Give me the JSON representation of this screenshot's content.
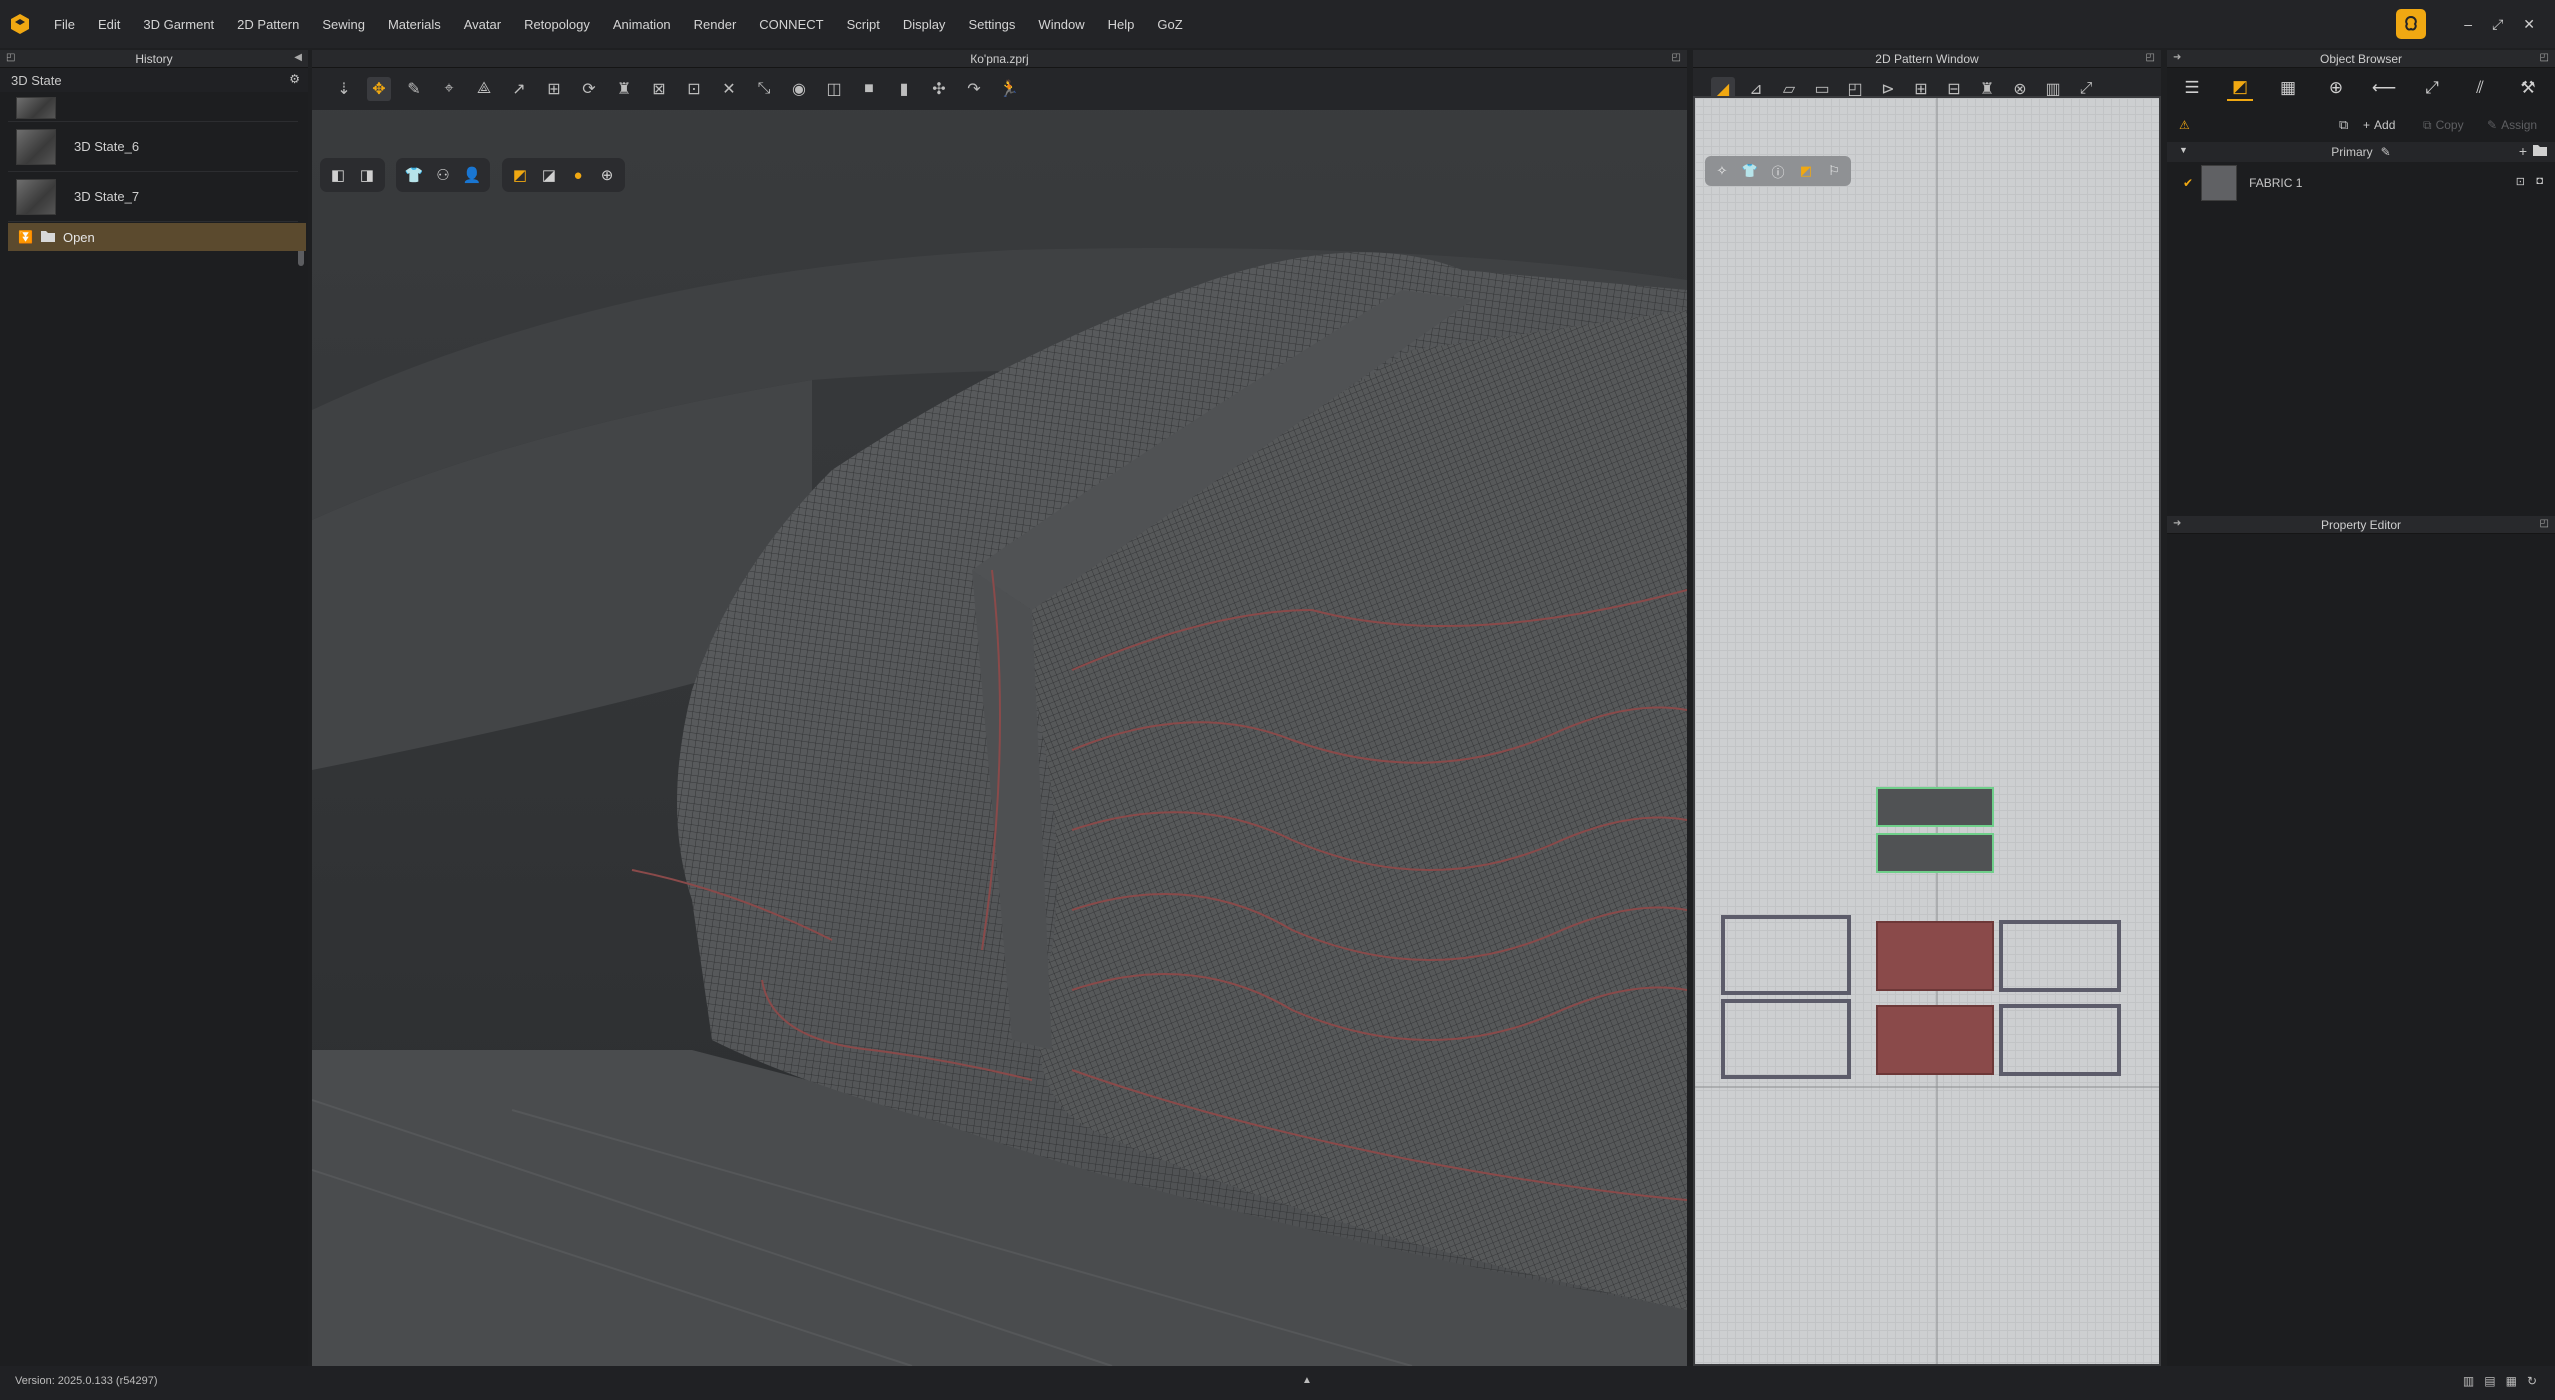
{
  "app": {
    "menu": [
      "File",
      "Edit",
      "3D Garment",
      "2D Pattern",
      "Sewing",
      "Materials",
      "Avatar",
      "Retopology",
      "Animation",
      "Render",
      "CONNECT",
      "Script",
      "Display",
      "Settings",
      "Window",
      "Help",
      "GoZ"
    ],
    "window_controls": [
      "–",
      "⤢",
      "✕"
    ]
  },
  "history": {
    "title": "History",
    "subhead": "3D State",
    "states": [
      {
        "label": "3D State_6"
      },
      {
        "label": "3D State_7"
      }
    ],
    "open_label": "Open"
  },
  "viewport": {
    "file_title": "Ко'рпа.zprj"
  },
  "pattern_window": {
    "title": "2D Pattern Window"
  },
  "object_browser": {
    "title": "Object Browser",
    "add_label": "Add",
    "copy_label": "Copy",
    "assign_label": "Assign",
    "primary_label": "Primary",
    "fabric_label": "FABRIC 1"
  },
  "property_editor": {
    "title": "Property Editor"
  },
  "status": {
    "version": "Version: 2025.0.133 (r54297)"
  },
  "colors": {
    "accent": "#f0a812",
    "selected_row": "#5b4a2e",
    "fabric_red": "#8a4a4a",
    "pattern_bg": "#cdcfd1"
  }
}
